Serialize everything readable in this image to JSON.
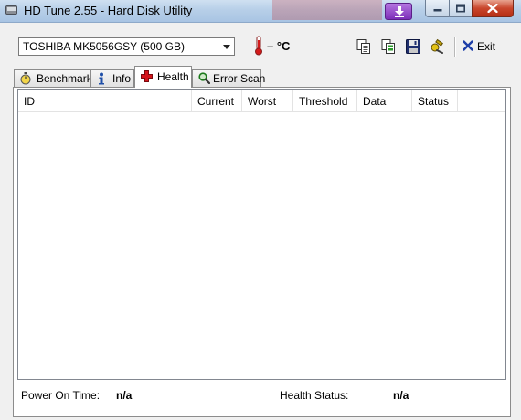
{
  "window": {
    "title": "HD Tune 2.55 - Hard Disk Utility"
  },
  "toolbar": {
    "drive": "TOSHIBA MK5056GSY (500 GB)",
    "temperature": "– °C",
    "exit_label": "Exit",
    "icons": [
      "copy-icon",
      "copy-all-icon",
      "save-icon",
      "options-icon",
      "exit-icon"
    ]
  },
  "tabs": [
    {
      "label": "Benchmark",
      "icon": "stopwatch-icon",
      "active": false
    },
    {
      "label": "Info",
      "icon": "info-icon",
      "active": false
    },
    {
      "label": "Health",
      "icon": "health-cross-icon",
      "active": true
    },
    {
      "label": "Error Scan",
      "icon": "magnifier-icon",
      "active": false
    }
  ],
  "health_table": {
    "columns": [
      "ID",
      "Current",
      "Worst",
      "Threshold",
      "Data",
      "Status"
    ],
    "rows": []
  },
  "status": {
    "power_on_label": "Power On Time:",
    "power_on_value": "n/a",
    "health_label": "Health Status:",
    "health_value": "n/a"
  },
  "colors": {
    "title_bar": "#b7cfe8",
    "close_button": "#c9462c",
    "download_button": "#7c2fb8",
    "health_icon": "#d4141b"
  }
}
